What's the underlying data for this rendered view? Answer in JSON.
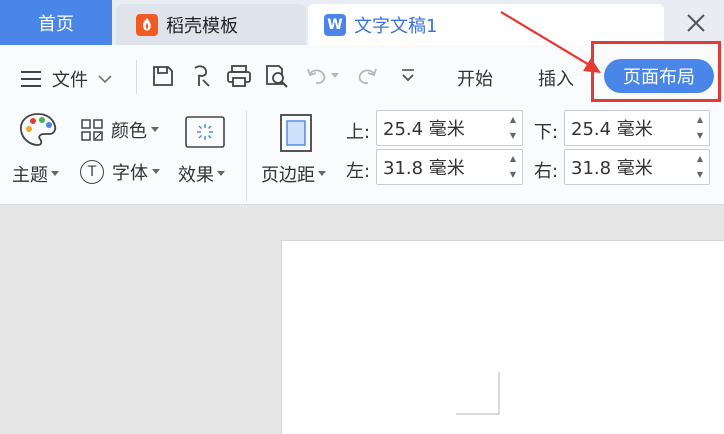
{
  "tabs": {
    "home": "首页",
    "template": "稻壳模板",
    "document": "文字文稿1",
    "template_badge_color": "#f15a22",
    "document_badge": "W",
    "document_badge_color": "#4a86e8"
  },
  "toolbar": {
    "file": "文件",
    "start": "开始",
    "insert": "插入",
    "page_layout": "页面布局"
  },
  "ribbon": {
    "theme": "主题",
    "color": "颜色",
    "font": "字体",
    "effect": "效果",
    "margin": "页边距",
    "font_badge": "T"
  },
  "margins": {
    "top_label": "上:",
    "top_value": "25.4 毫米",
    "bottom_label": "下:",
    "bottom_value": "25.4 毫米",
    "left_label": "左:",
    "left_value": "31.8 毫米",
    "right_label": "右:",
    "right_value": "31.8 毫米"
  },
  "colors": {
    "accent": "#4a86e8",
    "highlight": "#e53935"
  }
}
